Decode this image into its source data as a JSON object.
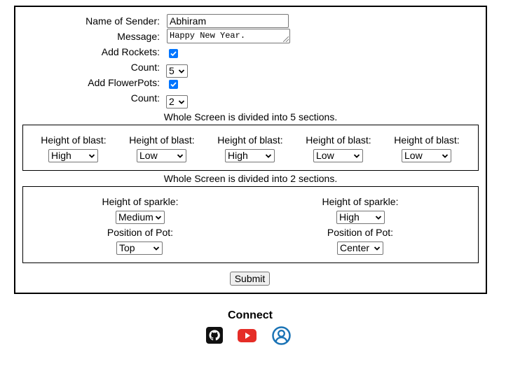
{
  "form": {
    "sender_label": "Name of Sender:",
    "sender_value": "Abhiram",
    "message_label": "Message:",
    "message_value": "Happy New Year.",
    "rockets_label": "Add Rockets:",
    "rockets_checked": true,
    "rocket_count_label": "Count:",
    "rocket_count_value": "5",
    "flowerpots_label": "Add FlowerPots:",
    "flowerpots_checked": true,
    "flowerpot_count_label": "Count:",
    "flowerpot_count_value": "2",
    "rockets_sections_text": "Whole Screen is divided into 5 sections.",
    "rocket_sections": [
      {
        "label": "Height of blast:",
        "value": "High"
      },
      {
        "label": "Height of blast:",
        "value": "Low"
      },
      {
        "label": "Height of blast:",
        "value": "High"
      },
      {
        "label": "Height of blast:",
        "value": "Low"
      },
      {
        "label": "Height of blast:",
        "value": "Low"
      }
    ],
    "flowerpots_sections_text": "Whole Screen is divided into 2 sections.",
    "flowerpot_sections": [
      {
        "sparkle_label": "Height of sparkle:",
        "sparkle_value": "Medium",
        "position_label": "Position of Pot:",
        "position_value": "Top"
      },
      {
        "sparkle_label": "Height of sparkle:",
        "sparkle_value": "High",
        "position_label": "Position of Pot:",
        "position_value": "Center"
      }
    ],
    "submit_label": "Submit"
  },
  "footer": {
    "connect_label": "Connect",
    "links": [
      {
        "icon": "github-icon"
      },
      {
        "icon": "youtube-icon"
      },
      {
        "icon": "user-profile-icon"
      }
    ]
  },
  "colors": {
    "checkbox_accent": "#0075ff",
    "youtube_red": "#e52d27",
    "profile_blue": "#1a73b5"
  }
}
